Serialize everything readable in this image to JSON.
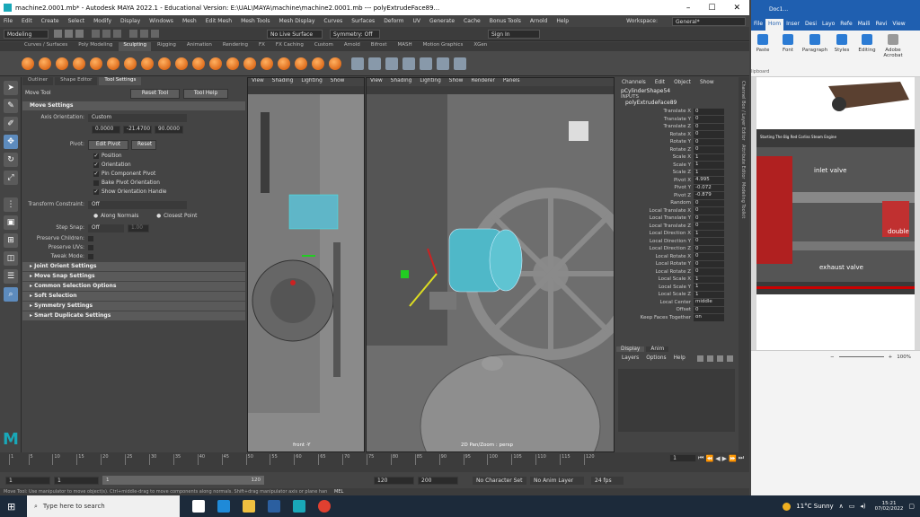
{
  "window": {
    "title": "machine2.0001.mb* - Autodesk MAYA 2022.1 - Educational Version: E:\\UAL\\MAYA\\machine\\machine2.0001.mb  ---  polyExtrudeFace89...",
    "min": "–",
    "max": "☐",
    "close": "✕"
  },
  "menu": [
    "File",
    "Edit",
    "Create",
    "Select",
    "Modify",
    "Display",
    "Windows",
    "Mesh",
    "Edit Mesh",
    "Mesh Tools",
    "Mesh Display",
    "Curves",
    "Surfaces",
    "Deform",
    "UV",
    "Generate",
    "Cache",
    "Bonus Tools",
    "Arnold",
    "Help"
  ],
  "workspace": {
    "label": "Workspace:",
    "value": "General*"
  },
  "status": {
    "mode": "Modeling",
    "live": "No Live Surface",
    "symmetry": "Symmetry: Off",
    "sign_in": "Sign In"
  },
  "shelf_tabs": [
    "Curves / Surfaces",
    "Poly Modeling",
    "Sculpting",
    "Rigging",
    "Animation",
    "Rendering",
    "FX",
    "FX Caching",
    "Custom",
    "Arnold",
    "Bifrost",
    "MASH",
    "Motion Graphics",
    "XGen"
  ],
  "shelf_active": "Sculpting",
  "attr": {
    "tabs": [
      "Outliner",
      "Shape Editor",
      "Tool Settings"
    ],
    "tool_name": "Move Tool",
    "reset": "Reset Tool",
    "help": "Tool Help",
    "move_settings": "Move Settings",
    "axis_label": "Axis Orientation:",
    "axis_value": "Custom",
    "vec": [
      "0.0000",
      "-21.4700",
      "90.0000"
    ],
    "pivot_label": "Pivot:",
    "edit_pivot": "Edit Pivot",
    "reset_pivot": "Reset",
    "checks": [
      {
        "label": "Position",
        "on": true
      },
      {
        "label": "Orientation",
        "on": true
      },
      {
        "label": "Pin Component Pivot",
        "on": true
      },
      {
        "label": "Bake Pivot Orientation",
        "on": false
      },
      {
        "label": "Show Orientation Handle",
        "on": true
      }
    ],
    "tc_label": "Transform Constraint:",
    "tc_value": "Off",
    "along_normals": "Along Normals",
    "closest_point": "Closest Point",
    "step_snap_label": "Step Snap:",
    "step_snap_value": "Off",
    "step_value": "1.00",
    "preserve_children": "Preserve Children:",
    "preserve_uvs": "Preserve UVs:",
    "tweak_mode": "Tweak Mode:",
    "sections": [
      "Joint Orient Settings",
      "Move Snap Settings",
      "Common Selection Options",
      "Soft Selection",
      "Symmetry Settings",
      "Smart Duplicate Settings"
    ]
  },
  "vp1": {
    "menu": [
      "View",
      "Shading",
      "Lighting",
      "Show"
    ],
    "label": "front -Y"
  },
  "vp2": {
    "menu": [
      "View",
      "Shading",
      "Lighting",
      "Show",
      "Renderer",
      "Panels"
    ],
    "label": "2D Pan/Zoom : persp"
  },
  "channel": {
    "menu": [
      "Channels",
      "Edit",
      "Object",
      "Show"
    ],
    "object": "pCylinderShape54",
    "inputs": "INPUTS",
    "node": "polyExtrudeFace89",
    "rows": [
      [
        "Translate X",
        "0"
      ],
      [
        "Translate Y",
        "0"
      ],
      [
        "Translate Z",
        "0"
      ],
      [
        "Rotate X",
        "0"
      ],
      [
        "Rotate Y",
        "0"
      ],
      [
        "Rotate Z",
        "0"
      ],
      [
        "Scale X",
        "1"
      ],
      [
        "Scale Y",
        "1"
      ],
      [
        "Scale Z",
        "1"
      ],
      [
        "Pivot X",
        "4.995"
      ],
      [
        "Pivot Y",
        "-0.072"
      ],
      [
        "Pivot Z",
        "-0.879"
      ],
      [
        "Random",
        "0"
      ],
      [
        "Local Translate X",
        "0"
      ],
      [
        "Local Translate Y",
        "0"
      ],
      [
        "Local Translate Z",
        "0"
      ],
      [
        "Local Direction X",
        "1"
      ],
      [
        "Local Direction Y",
        "0"
      ],
      [
        "Local Direction Z",
        "0"
      ],
      [
        "Local Rotate X",
        "0"
      ],
      [
        "Local Rotate Y",
        "0"
      ],
      [
        "Local Rotate Z",
        "0"
      ],
      [
        "Local Scale X",
        "1"
      ],
      [
        "Local Scale Y",
        "1"
      ],
      [
        "Local Scale Z",
        "1"
      ],
      [
        "Local Center",
        "middle"
      ],
      [
        "Offset",
        "0"
      ],
      [
        "Keep Faces Together",
        "on"
      ]
    ]
  },
  "side_tabs": [
    "Channel Box / Layer Editor",
    "Attribute Editor",
    "Modeling Toolkit"
  ],
  "layer": {
    "tabs": [
      "Display",
      "Anim"
    ],
    "menu": [
      "Layers",
      "Options",
      "Help"
    ]
  },
  "timeline": {
    "ticks": [
      "1",
      "5",
      "10",
      "15",
      "20",
      "25",
      "30",
      "35",
      "40",
      "45",
      "50",
      "55",
      "60",
      "65",
      "70",
      "75",
      "80",
      "85",
      "90",
      "95",
      "100",
      "105",
      "110",
      "115",
      "120"
    ],
    "current": "1"
  },
  "range": {
    "start": "1",
    "start2": "1",
    "slider_start": "1",
    "slider_end": "120",
    "end": "120",
    "end2": "200",
    "char_set": "No Character Set",
    "anim_layer": "No Anim Layer",
    "fps": "24 fps"
  },
  "cmd": {
    "help": "Move Tool: Use manipulator to move object(s). Ctrl+middle-drag to move components along normals. Shift+drag manipulator axis or plane handle to extrude components or clone objects.",
    "mel": "MEL"
  },
  "word": {
    "title": "Doc1...",
    "tabs": [
      "File",
      "Hom",
      "Inser",
      "Desi",
      "Layo",
      "Refe",
      "Maili",
      "Revi",
      "View"
    ],
    "ribbon": [
      "Paste",
      "Font",
      "Paragraph",
      "Styles",
      "Editing",
      "Adobe Acrobat"
    ],
    "clipboard": "lipboard",
    "video_title": "Starting The Big Red Corliss Steam Engine",
    "labels": [
      "inlet valve",
      "double",
      "exhaust valve"
    ],
    "zoom": "100%"
  },
  "taskbar": {
    "search": "Type here to search",
    "weather": "11°C  Sunny",
    "time": "15:21",
    "date": "07/02/2022"
  }
}
